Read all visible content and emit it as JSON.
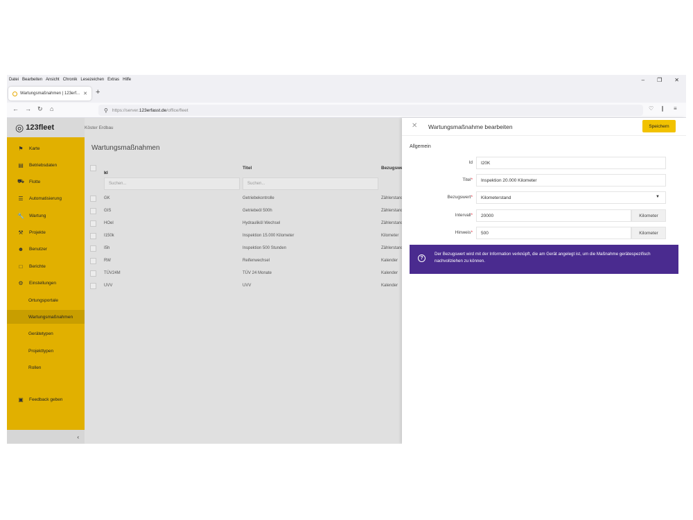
{
  "browser": {
    "menu": [
      "Datei",
      "Bearbeiten",
      "Ansicht",
      "Chronik",
      "Lesezeichen",
      "Extras",
      "Hilfe"
    ],
    "tab_title": "Wartungsmaßnahmen | 123erf...",
    "url_prefix": "https://server.",
    "url_domain": "123erfasst.de",
    "url_path": "/office/fleet"
  },
  "app": {
    "logo_text": "123fleet",
    "company": "Köster Erdbau",
    "sidebar": {
      "items": [
        {
          "label": "Karte",
          "icon": "map-icon"
        },
        {
          "label": "Betriebsdaten",
          "icon": "document-icon"
        },
        {
          "label": "Flotte",
          "icon": "truck-icon"
        },
        {
          "label": "Automatisierung",
          "icon": "sliders-icon"
        },
        {
          "label": "Wartung",
          "icon": "wrench-icon"
        },
        {
          "label": "Projekte",
          "icon": "excavator-icon"
        },
        {
          "label": "Benutzer",
          "icon": "users-icon"
        },
        {
          "label": "Berichte",
          "icon": "report-icon"
        },
        {
          "label": "Einstellungen",
          "icon": "gear-icon"
        }
      ],
      "subitems": [
        "Ortungsportale",
        "Wartungsmaßnahmen",
        "Gerätetypen",
        "Projekttypen",
        "Rollen"
      ],
      "active_subitem": "Wartungsmaßnahmen",
      "feedback": "Feedback geben"
    },
    "main": {
      "title": "Wartungsmaßnahmen",
      "columns": [
        "Id",
        "Titel",
        "Bezugswert"
      ],
      "filter_placeholder": "Suchen...",
      "rows": [
        {
          "id": "GK",
          "titel": "Getriebekontrolle",
          "bezug": "Zählerstand"
        },
        {
          "id": "GIS",
          "titel": "Getriebeöl 500h",
          "bezug": "Zählerstand"
        },
        {
          "id": "HOel",
          "titel": "Hydrauliköl Wechsel",
          "bezug": "Zählerstand"
        },
        {
          "id": "I150k",
          "titel": "Inspektion 15.000 Kilometer",
          "bezug": "Kilometer"
        },
        {
          "id": "I5h",
          "titel": "Inspektion 500 Stunden",
          "bezug": "Zählerstand"
        },
        {
          "id": "RW",
          "titel": "Reifenwechsel",
          "bezug": "Kalender"
        },
        {
          "id": "TÜV24M",
          "titel": "TÜV 24 Monate",
          "bezug": "Kalender"
        },
        {
          "id": "UVV",
          "titel": "UVV",
          "bezug": "Kalender"
        }
      ]
    },
    "panel": {
      "title": "Wartungsmaßnahme bearbeiten",
      "save": "Speichern",
      "section": "Allgemein",
      "fields": {
        "id": {
          "label": "Id",
          "value": "I20K"
        },
        "titel": {
          "label": "Titel",
          "value": "Inspektion 20.000 Kilometer"
        },
        "bezugswert": {
          "label": "Bezugswert",
          "value": "Kilometerstand"
        },
        "intervall": {
          "label": "Intervall",
          "value": "20000",
          "unit": "Kilometer"
        },
        "hinweis": {
          "label": "Hinweis",
          "value": "500",
          "unit": "Kilometer"
        }
      },
      "info": "Der Bezugswert wird mit der Information verknüpft, die am Gerät angelegt ist, um die Maßnahme gerätespezifisch nachvollziehen zu können."
    }
  }
}
